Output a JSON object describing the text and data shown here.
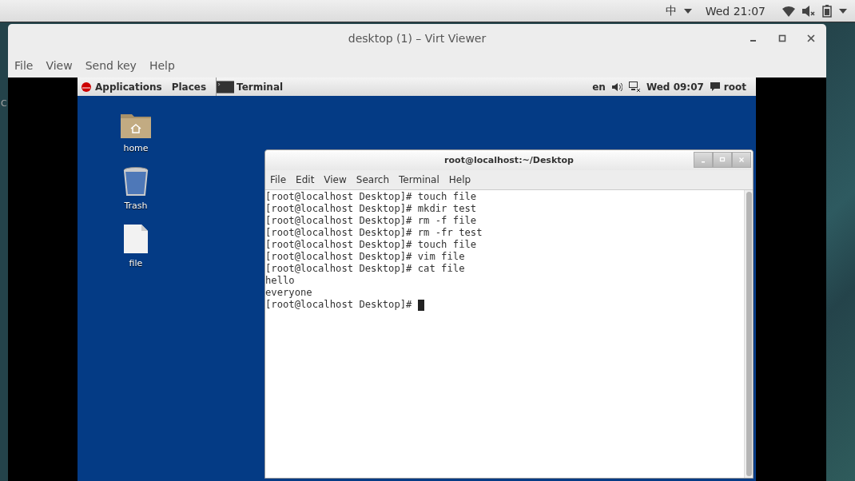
{
  "host_top_bar": {
    "input_method": "中",
    "clock": "Wed 21:07"
  },
  "host_desktop": {
    "edge_text": "C"
  },
  "window": {
    "title": "desktop (1) – Virt Viewer"
  },
  "menu": [
    "File",
    "View",
    "Send key",
    "Help"
  ],
  "guest": {
    "top_bar": {
      "applications": "Applications",
      "places": "Places",
      "task": "Terminal",
      "language": "en",
      "clock": "Wed 09:07",
      "user": "root"
    },
    "desktop_icons": [
      {
        "kind": "folder",
        "label": "home"
      },
      {
        "kind": "trash",
        "label": "Trash"
      },
      {
        "kind": "file",
        "label": "file"
      }
    ],
    "terminal": {
      "title": "root@localhost:~/Desktop",
      "menu": [
        "File",
        "Edit",
        "View",
        "Search",
        "Terminal",
        "Help"
      ],
      "lines": [
        "[root@localhost Desktop]# touch file",
        "[root@localhost Desktop]# mkdir test",
        "[root@localhost Desktop]# rm -f file",
        "[root@localhost Desktop]# rm -fr test",
        "[root@localhost Desktop]# touch file",
        "[root@localhost Desktop]# vim file",
        "[root@localhost Desktop]# cat file",
        "hello",
        "everyone",
        "[root@localhost Desktop]# "
      ],
      "cursor": true
    }
  }
}
